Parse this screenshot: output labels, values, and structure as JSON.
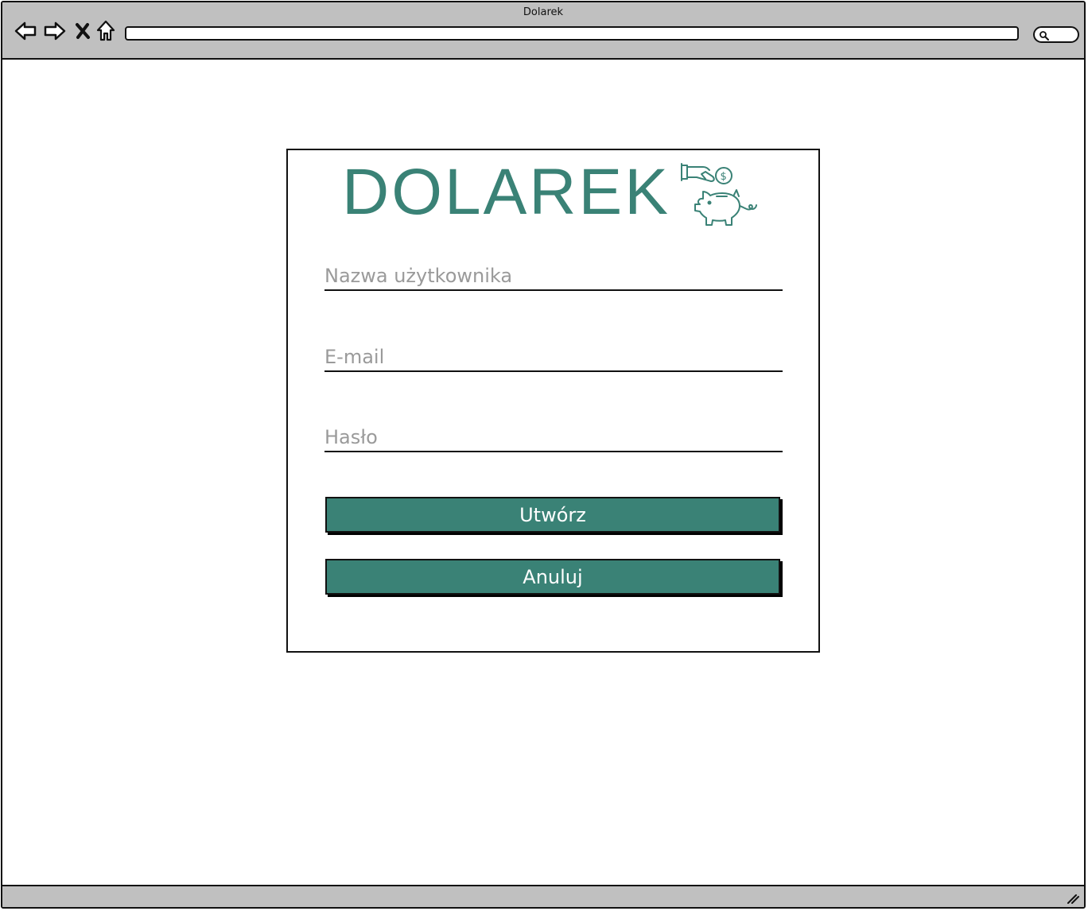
{
  "window": {
    "title": "Dolarek"
  },
  "browser": {
    "address_value": "",
    "search_value": ""
  },
  "form": {
    "logo_text": "DOLAREK",
    "username_placeholder": "Nazwa użytkownika",
    "email_placeholder": "E-mail",
    "password_placeholder": "Hasło",
    "create_label": "Utwórz",
    "cancel_label": "Anuluj"
  },
  "colors": {
    "accent": "#3a8276",
    "chrome": "#c0c0c0",
    "placeholder": "#9a9a9a"
  },
  "icons": {
    "back": "back-arrow-icon",
    "forward": "forward-arrow-icon",
    "stop": "close-icon",
    "home": "home-icon",
    "search": "search-icon",
    "logo": "piggy-bank-icon"
  }
}
